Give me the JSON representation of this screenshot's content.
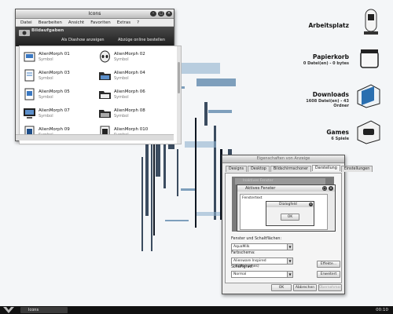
{
  "icons_window": {
    "title": "Icons",
    "menu": [
      "Datei",
      "Bearbeiten",
      "Ansicht",
      "Favoriten",
      "Extras",
      "?"
    ],
    "task_panel": {
      "title": "Bildaufgaben",
      "tasks": [
        "Als Diashow anzeigen",
        "Abzüge online bestellen"
      ]
    },
    "items": [
      {
        "name": "AlienMorph 01",
        "type": "Symbol"
      },
      {
        "name": "AlienMorph 02",
        "type": "Symbol"
      },
      {
        "name": "AlienMorph 03",
        "type": "Symbol"
      },
      {
        "name": "AlienMorph 04",
        "type": "Symbol"
      },
      {
        "name": "AlienMorph 05",
        "type": "Symbol"
      },
      {
        "name": "AlienMorph 06",
        "type": "Symbol"
      },
      {
        "name": "AlienMorph 07",
        "type": "Symbol"
      },
      {
        "name": "AlienMorph 08",
        "type": "Symbol"
      },
      {
        "name": "AlienMorph 09",
        "type": "Symbol"
      },
      {
        "name": "AlienMorph 010",
        "type": "Symbol"
      }
    ]
  },
  "desktop": {
    "icons": [
      {
        "label": "Arbeitsplatz",
        "sub": ""
      },
      {
        "label": "Papierkorb",
        "sub": "0 Datei(en) - 0 bytes"
      },
      {
        "label": "Downloads",
        "sub": "1608 Datei(en) - 43 Ordner"
      },
      {
        "label": "Games",
        "sub": "6 Spiele"
      }
    ]
  },
  "dialog": {
    "title": "Eigenschaften von Anzeige",
    "tabs": [
      "Designs",
      "Desktop",
      "Bildschirmschoner",
      "Darstellung",
      "Einstellungen"
    ],
    "active_tab": "Darstellung",
    "preview": {
      "inactive_title": "Inaktives Fenster",
      "active_title": "Aktives Fenster",
      "window_text": "Fenstertext",
      "msg_title": "Dialogfeld",
      "ok": "OK"
    },
    "style_label": "Fenster und Schaltflächen:",
    "style_value": "AquaMilk",
    "scheme_label": "Farbschema:",
    "scheme_value": "Alienware Inspired (digitalnames)",
    "font_label": "Schriftgrad:",
    "font_value": "Normal",
    "effects": "Effekte...",
    "advanced": "Erweitert",
    "ok": "OK",
    "cancel": "Abbrechen",
    "apply": "Übernehmen"
  },
  "taskbar": {
    "task": "Icons",
    "clock": "00:10"
  }
}
